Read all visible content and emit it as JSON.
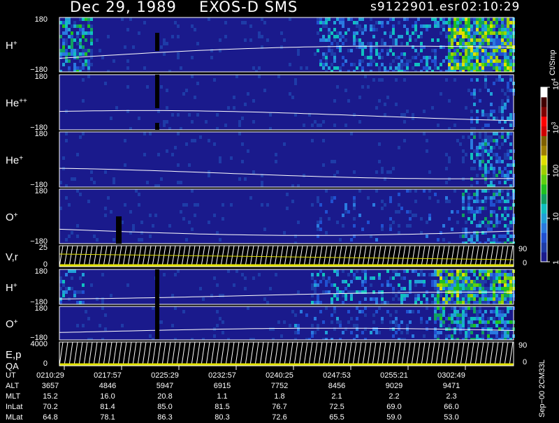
{
  "header": {
    "date": "Dec 29, 1989",
    "instrument": "EXOS-D SMS",
    "file": "s9122901.esr",
    "time": "02:10:29"
  },
  "colorbar": {
    "unit": "Ct/Smp",
    "ticks": [
      {
        "label": "1",
        "value": 1
      },
      {
        "label": "10",
        "value": 10
      },
      {
        "label": "100",
        "value": 100
      },
      {
        "label": "10",
        "sup": "3",
        "value": 1000
      },
      {
        "label": "10",
        "sup": "4",
        "value": 10000
      }
    ],
    "colors": [
      "#1a1a8c",
      "#1e3ca8",
      "#2050d0",
      "#2a7ae0",
      "#20a0d8",
      "#10c0c0",
      "#10a060",
      "#20c020",
      "#60d010",
      "#a0d000",
      "#e0e000",
      "#a08000",
      "#806000",
      "#d00000",
      "#ff0000",
      "#800000",
      "#400000",
      "#ffffff"
    ]
  },
  "panels": [
    {
      "label": "H",
      "sup": "+",
      "ymax": "180",
      "ymin": "−180"
    },
    {
      "label": "He",
      "sup": "++",
      "ymax": "180",
      "ymin": "−180"
    },
    {
      "label": "He",
      "sup": "+",
      "ymax": "180",
      "ymin": "−180"
    },
    {
      "label": "O",
      "sup": "+",
      "ymax": "180",
      "ymin": "−180"
    },
    {
      "label": "V,r",
      "sup": "",
      "ymax": "25",
      "ymin": "0",
      "rmax": "90",
      "rmin": "0"
    },
    {
      "label": "H",
      "sup": "+",
      "ymax": "180",
      "ymin": "−180"
    },
    {
      "label": "O",
      "sup": "+",
      "ymax": "180",
      "ymin": "−180"
    },
    {
      "label": "E,p",
      "label2": "QA",
      "sup": "",
      "ymax": "4000",
      "ymin": "0",
      "rmax": "90",
      "rmin": "0"
    }
  ],
  "chart_data": {
    "type": "heatmap",
    "title": "Dec 29, 1989   EXOS-D SMS",
    "colorbar_label": "Ct/Smp",
    "colorbar_scale": "log",
    "colorbar_range": [
      1,
      10000
    ],
    "panels_ylim": [
      [
        -180,
        180
      ],
      [
        -180,
        180
      ],
      [
        -180,
        180
      ],
      [
        -180,
        180
      ],
      [
        0,
        25
      ],
      [
        -180,
        180
      ],
      [
        -180,
        180
      ],
      [
        0,
        4000
      ]
    ],
    "x_ticks": [
      "0210:29",
      "0217:57",
      "0225:29",
      "0232:57",
      "0240:25",
      "0247:53",
      "0255:21",
      "0302:49"
    ],
    "ephemeris": {
      "UT": [
        "0210:29",
        "0217:57",
        "0225:29",
        "0232:57",
        "0240:25",
        "0247:53",
        "0255:21",
        "0302:49"
      ],
      "ALT": [
        "3657",
        "4846",
        "5947",
        "6915",
        "7752",
        "8456",
        "9029",
        "9471"
      ],
      "MLT": [
        "15.2",
        "16.0",
        "20.8",
        "1.1",
        "1.8",
        "2.1",
        "2.2",
        "2.3"
      ],
      "InLat": [
        "70.2",
        "81.4",
        "85.0",
        "81.5",
        "76.7",
        "72.5",
        "69.0",
        "66.0"
      ],
      "MLat": [
        "64.8",
        "78.1",
        "86.3",
        "80.3",
        "72.6",
        "65.5",
        "59.0",
        "53.0"
      ]
    }
  },
  "footer": {
    "rows": [
      {
        "label": "UT",
        "key": "UT"
      },
      {
        "label": "ALT",
        "key": "ALT"
      },
      {
        "label": "MLT",
        "key": "MLT"
      },
      {
        "label": "InLat",
        "key": "InLat"
      },
      {
        "label": "MLat",
        "key": "MLat"
      }
    ],
    "sidenote": "Sep−00  2CM33L"
  }
}
